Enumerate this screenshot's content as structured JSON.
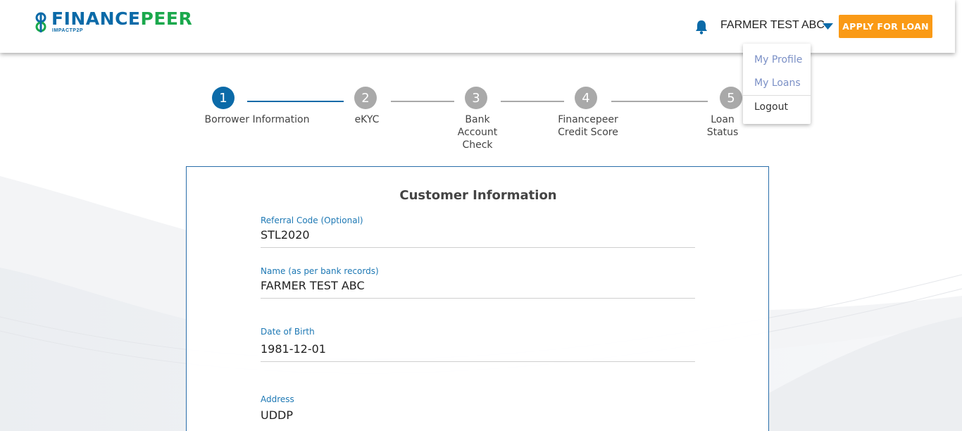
{
  "header": {
    "logo_main_a": "FINANCE",
    "logo_main_b": "PEER",
    "logo_sub": "IMPACTP2P",
    "user_name": "FARMER TEST ABC",
    "apply_label": "APPLY FOR LOAN",
    "icons": [
      "bell-icon",
      "caret-down-icon",
      "logo-mark-icon"
    ]
  },
  "user_menu": {
    "items": [
      {
        "label": "My Profile"
      },
      {
        "label": "My Loans"
      },
      {
        "label": "Logout"
      }
    ]
  },
  "stepper": {
    "steps": [
      {
        "number": "1",
        "label_lines": [
          "Borrower Information"
        ],
        "status": "active"
      },
      {
        "number": "2",
        "label_lines": [
          "eKYC"
        ],
        "status": "pending"
      },
      {
        "number": "3",
        "label_lines": [
          "Bank",
          "Account",
          "Check"
        ],
        "status": "pending"
      },
      {
        "number": "4",
        "label_lines": [
          "Financepeer",
          "Credit Score"
        ],
        "status": "pending"
      },
      {
        "number": "5",
        "label_lines": [
          "Loan",
          "Status"
        ],
        "status": "pending"
      }
    ]
  },
  "form": {
    "title": "Customer Information",
    "fields": [
      {
        "label": "Referral Code (Optional)",
        "value": "STL2020"
      },
      {
        "label": "Name (as per bank records)",
        "value": "FARMER TEST ABC"
      },
      {
        "label": "Date of Birth",
        "value": "1981-12-01"
      },
      {
        "label": "Address",
        "value": "UDDP"
      }
    ]
  },
  "colors": {
    "brand_blue": "#0b6aa8",
    "brand_green": "#1aa84c",
    "accent_orange": "#fa9a16",
    "step_inactive": "#a9a9a9",
    "menu_link": "#7b90c6"
  }
}
